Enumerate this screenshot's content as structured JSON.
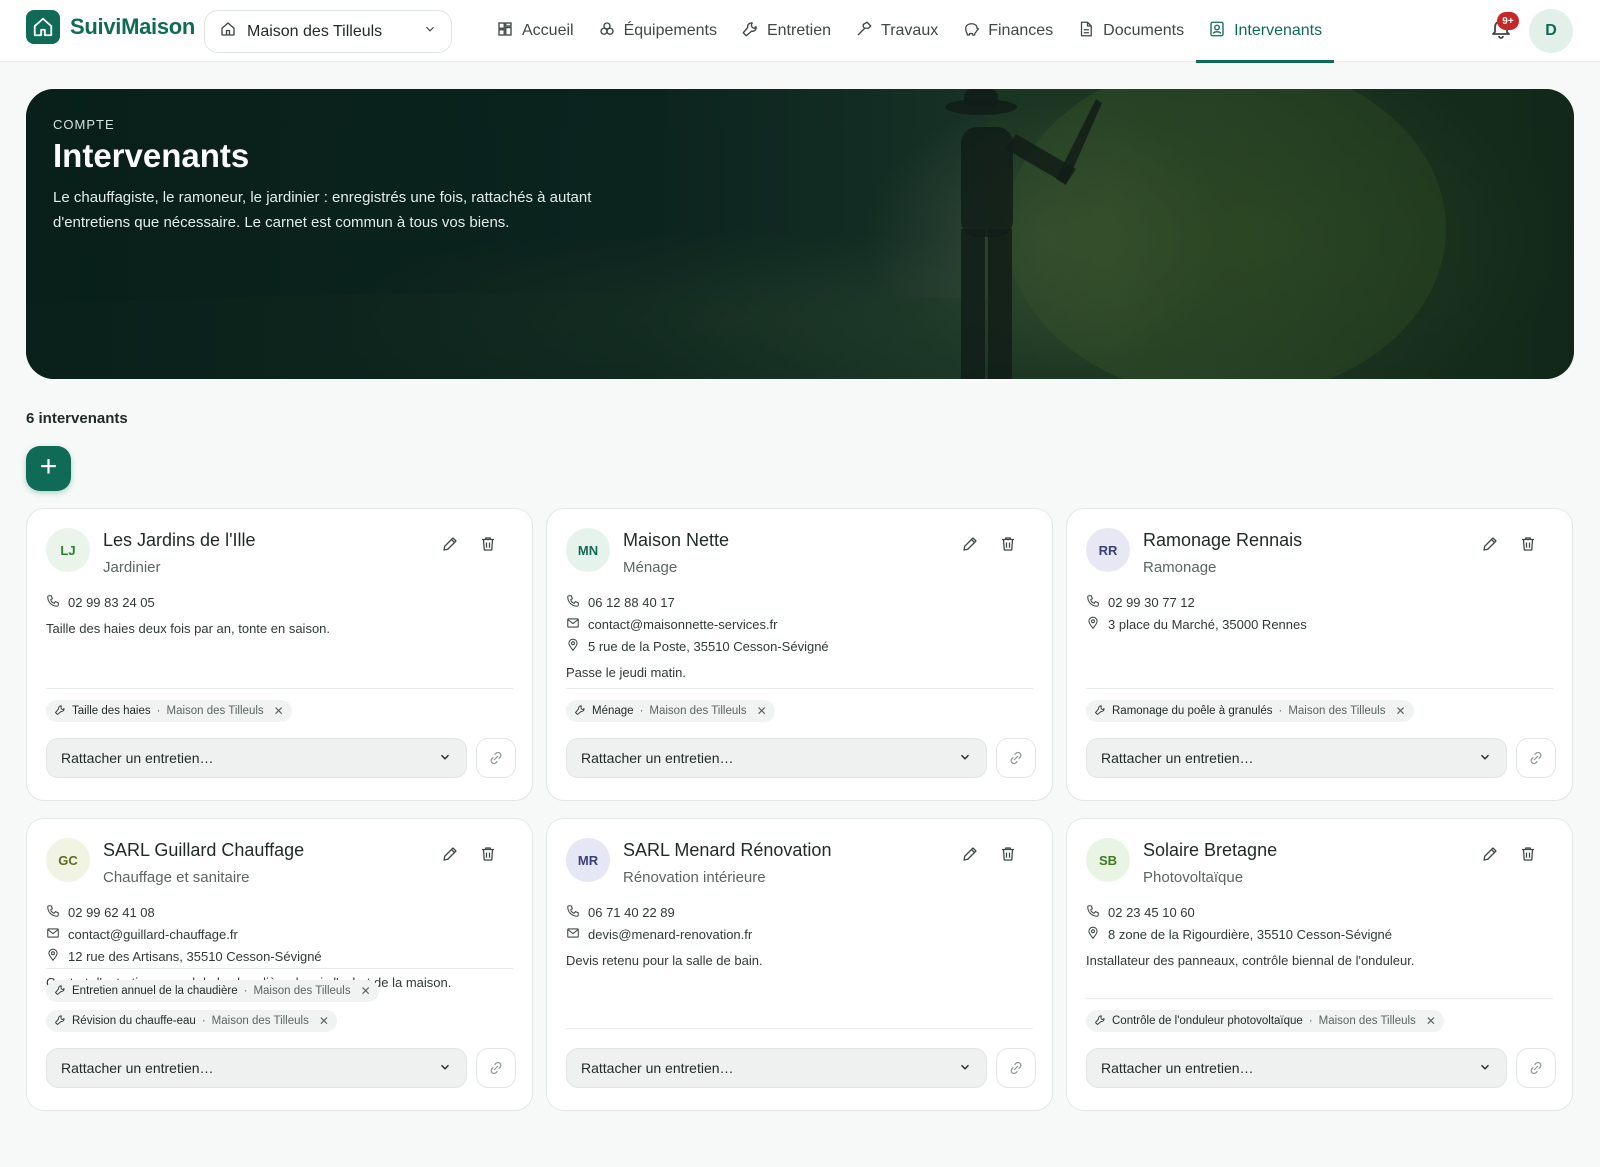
{
  "app": {
    "name": "SuiviMaison"
  },
  "property_selector": {
    "value": "Maison des Tilleuls"
  },
  "nav": [
    {
      "label": "Accueil",
      "icon": "grid-icon"
    },
    {
      "label": "Équipements",
      "icon": "cogs-icon"
    },
    {
      "label": "Entretien",
      "icon": "wrench-icon"
    },
    {
      "label": "Travaux",
      "icon": "hammer-icon"
    },
    {
      "label": "Finances",
      "icon": "piggy-bank-icon"
    },
    {
      "label": "Documents",
      "icon": "document-icon"
    },
    {
      "label": "Intervenants",
      "icon": "contact-icon",
      "active": true
    }
  ],
  "notifications": {
    "badge": "9+"
  },
  "user": {
    "initial": "D"
  },
  "hero": {
    "eyebrow": "COMPTE",
    "title": "Intervenants",
    "description": "Le chauffagiste, le ramoneur, le jardinier : enregistrés une fois, rattachés à autant d'entretiens que nécessaire. Le carnet est commun à tous vos biens."
  },
  "list": {
    "count_label": "6 intervenants",
    "add_label": "+"
  },
  "select_placeholder": "Rattacher un entretien…",
  "contractors": [
    {
      "initials": "LJ",
      "name": "Les Jardins de l'Ille",
      "role": "Jardinier",
      "avatar_bg": "#eaf4ea",
      "avatar_fg": "#2e7d32",
      "phone": "02 99 83 24 05",
      "email": "",
      "address": "",
      "note": "Taille des haies deux fois par an, tonte en saison.",
      "tags": [
        {
          "task": "Taille des haies",
          "property": "Maison des Tilleuls"
        }
      ]
    },
    {
      "initials": "MN",
      "name": "Maison Nette",
      "role": "Ménage",
      "avatar_bg": "#e6f3ec",
      "avatar_fg": "#0f6b55",
      "phone": "06 12 88 40 17",
      "email": "contact@maisonnette-services.fr",
      "address": "5 rue de la Poste, 35510 Cesson-Sévigné",
      "note": "Passe le jeudi matin.",
      "tags": [
        {
          "task": "Ménage",
          "property": "Maison des Tilleuls"
        }
      ]
    },
    {
      "initials": "RR",
      "name": "Ramonage Rennais",
      "role": "Ramonage",
      "avatar_bg": "#e8e8f5",
      "avatar_fg": "#3a3f7a",
      "phone": "02 99 30 77 12",
      "email": "",
      "address": "3 place du Marché, 35000 Rennes",
      "note": "",
      "tags": [
        {
          "task": "Ramonage du poêle à granulés",
          "property": "Maison des Tilleuls"
        }
      ]
    },
    {
      "initials": "GC",
      "name": "SARL Guillard Chauffage",
      "role": "Chauffage et sanitaire",
      "avatar_bg": "#f1f3e3",
      "avatar_fg": "#5d6b1f",
      "phone": "02 99 62 41 08",
      "email": "contact@guillard-chauffage.fr",
      "address": "12 rue des Artisans, 35510 Cesson-Sévigné",
      "note": "Contrat d'entretien annuel de la chaudière depuis l'achat de la maison.",
      "tags": [
        {
          "task": "Entretien annuel de la chaudière",
          "property": "Maison des Tilleuls"
        },
        {
          "task": "Révision du chauffe-eau",
          "property": "Maison des Tilleuls"
        }
      ]
    },
    {
      "initials": "MR",
      "name": "SARL Menard Rénovation",
      "role": "Rénovation intérieure",
      "avatar_bg": "#e6e7f4",
      "avatar_fg": "#3a3f7a",
      "phone": "06 71 40 22 89",
      "email": "devis@menard-renovation.fr",
      "address": "",
      "note": "Devis retenu pour la salle de bain.",
      "tags": []
    },
    {
      "initials": "SB",
      "name": "Solaire Bretagne",
      "role": "Photovoltaïque",
      "avatar_bg": "#eaf4e4",
      "avatar_fg": "#3f7a23",
      "phone": "02 23 45 10 60",
      "email": "",
      "address": "8 zone de la Rigourdière, 35510 Cesson-Sévigné",
      "note": "Installateur des panneaux, contrôle biennal de l'onduleur.",
      "tags": [
        {
          "task": "Contrôle de l'onduleur photovoltaïque",
          "property": "Maison des Tilleuls"
        }
      ]
    }
  ]
}
